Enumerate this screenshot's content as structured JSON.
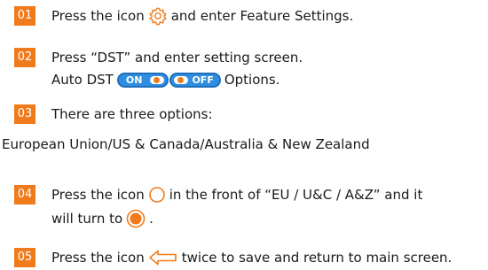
{
  "colors": {
    "accent": "#f07b1c",
    "toggle_blue": "#2f8ee0",
    "text": "#1a1a1a"
  },
  "steps": [
    {
      "num": "01",
      "text_before_icon": "Press the icon",
      "icon": "gear-icon",
      "text_after_icon": "and enter Feature Settings."
    },
    {
      "num": "02",
      "line1": "Press “DST” and enter setting screen.",
      "line2_before": "Auto DST",
      "toggle_on_label": "ON",
      "toggle_off_label": "OFF",
      "line2_after": "Options."
    },
    {
      "num": "03",
      "line1": "There are three options:",
      "line2": "European Union/US & Canada/Australia & New Zealand"
    },
    {
      "num": "04",
      "text_before_icon": "Press the icon",
      "icon": "radio-empty-icon",
      "text_after_icon": "in the front of “EU / U&C / A&Z” and it",
      "line2_before": "will turn to",
      "icon2": "radio-selected-icon",
      "line2_after": "."
    },
    {
      "num": "05",
      "text_before_icon": "Press the icon",
      "icon": "back-arrow-icon",
      "text_after_icon": "twice to save and return to main screen."
    }
  ]
}
